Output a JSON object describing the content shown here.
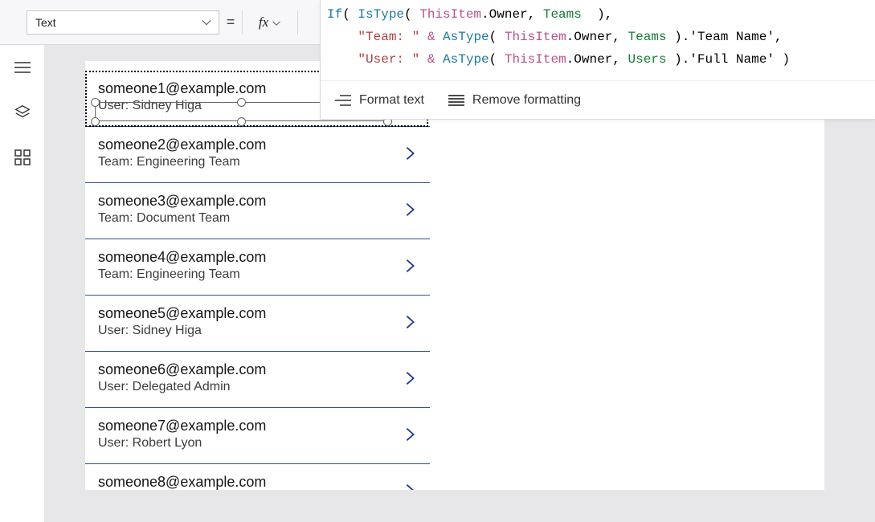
{
  "topbar": {
    "property_name": "Text",
    "equals": "="
  },
  "formula": {
    "tokens": [
      [
        {
          "cls": "tk-fn",
          "t": "If"
        },
        {
          "cls": "",
          "t": "( "
        },
        {
          "cls": "tk-fn",
          "t": "IsType"
        },
        {
          "cls": "",
          "t": "( "
        },
        {
          "cls": "tk-kw",
          "t": "ThisItem"
        },
        {
          "cls": "",
          "t": ".Owner, "
        },
        {
          "cls": "tk-prop",
          "t": "Teams"
        },
        {
          "cls": "",
          "t": "  ),"
        }
      ],
      [
        {
          "cls": "",
          "t": "    "
        },
        {
          "cls": "tk-str",
          "t": "\"Team: \""
        },
        {
          "cls": "",
          "t": " "
        },
        {
          "cls": "tk-amp",
          "t": "&"
        },
        {
          "cls": "",
          "t": " "
        },
        {
          "cls": "tk-fn",
          "t": "AsType"
        },
        {
          "cls": "",
          "t": "( "
        },
        {
          "cls": "tk-kw",
          "t": "ThisItem"
        },
        {
          "cls": "",
          "t": ".Owner, "
        },
        {
          "cls": "tk-prop",
          "t": "Teams"
        },
        {
          "cls": "",
          "t": " ).'Team Name',"
        }
      ],
      [
        {
          "cls": "",
          "t": "    "
        },
        {
          "cls": "tk-str",
          "t": "\"User: \""
        },
        {
          "cls": "",
          "t": " "
        },
        {
          "cls": "tk-amp",
          "t": "&"
        },
        {
          "cls": "",
          "t": " "
        },
        {
          "cls": "tk-fn",
          "t": "AsType"
        },
        {
          "cls": "",
          "t": "( "
        },
        {
          "cls": "tk-kw",
          "t": "ThisItem"
        },
        {
          "cls": "",
          "t": ".Owner, "
        },
        {
          "cls": "tk-prop",
          "t": "Users"
        },
        {
          "cls": "",
          "t": " ).'Full Name' )"
        }
      ]
    ],
    "format_label": "Format text",
    "remove_label": "Remove formatting"
  },
  "gallery": {
    "rows": [
      {
        "email": "someone1@example.com",
        "sub": "User: Sidney Higa",
        "selected": true
      },
      {
        "email": "someone2@example.com",
        "sub": "Team: Engineering Team"
      },
      {
        "email": "someone3@example.com",
        "sub": "Team: Document Team"
      },
      {
        "email": "someone4@example.com",
        "sub": "Team: Engineering Team"
      },
      {
        "email": "someone5@example.com",
        "sub": "User: Sidney Higa"
      },
      {
        "email": "someone6@example.com",
        "sub": "User: Delegated Admin"
      },
      {
        "email": "someone7@example.com",
        "sub": "User: Robert Lyon"
      },
      {
        "email": "someone8@example.com",
        "sub": ""
      }
    ]
  }
}
